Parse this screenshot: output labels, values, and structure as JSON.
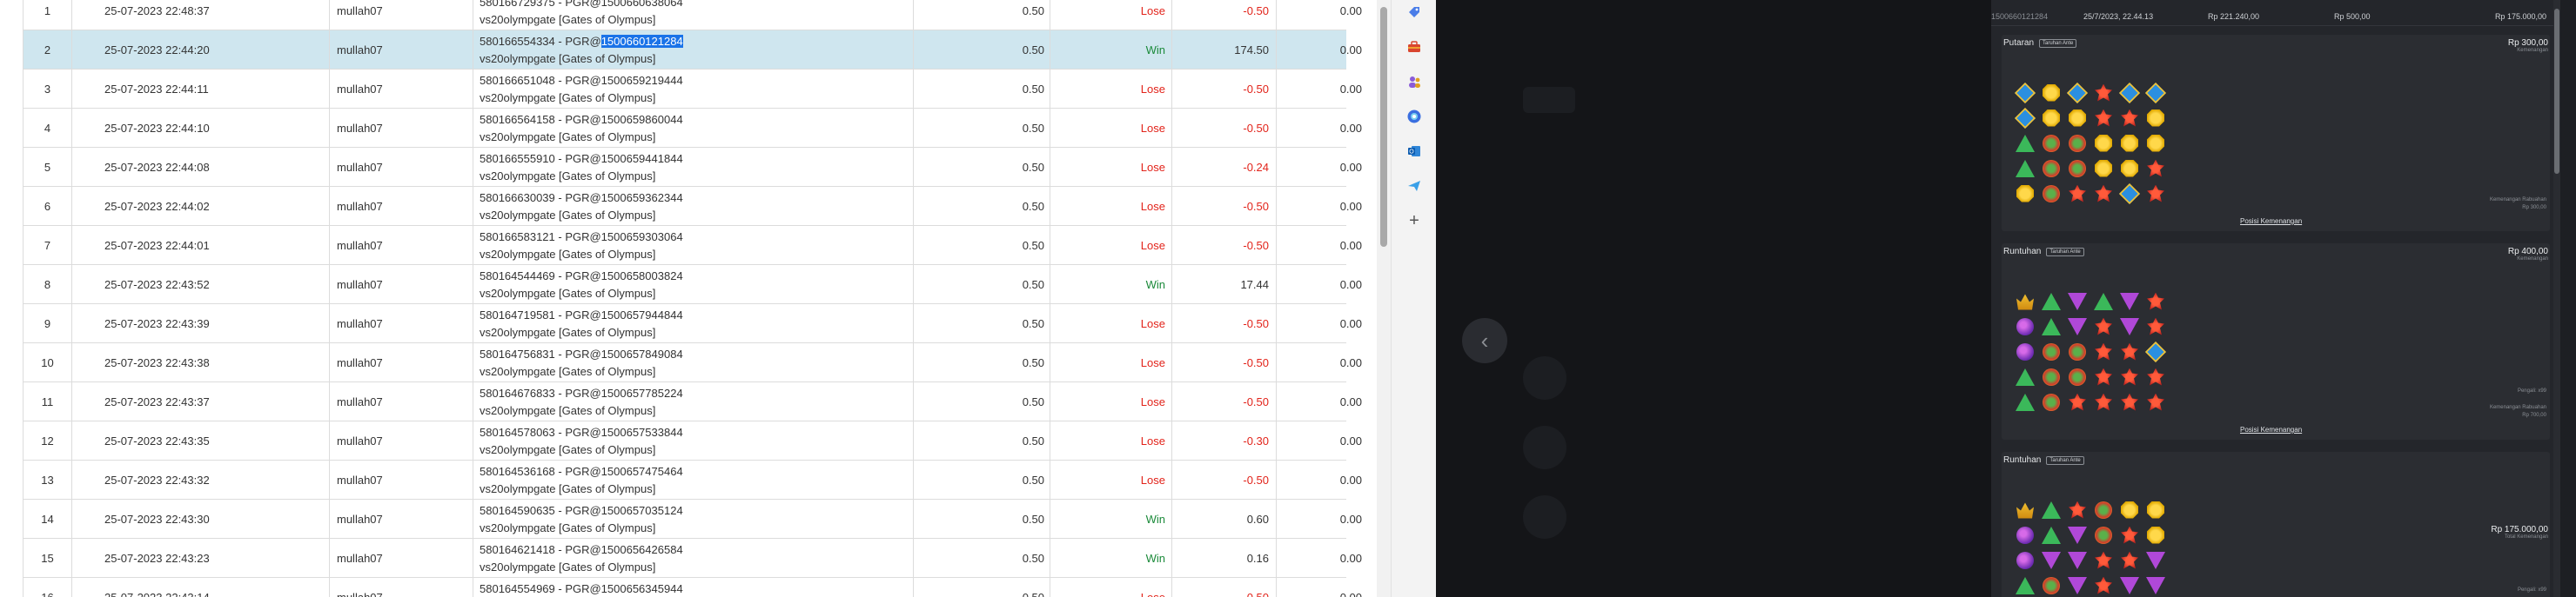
{
  "grid": {
    "rows": [
      {
        "no": "1",
        "date": "25-07-2023 22:48:37",
        "user": "mullah07",
        "desc1": "580166729375 - PGR@1500660638064",
        "desc2": "vs20olympgate [Gates of Olympus]",
        "bet": "0.50",
        "result": "Lose",
        "pl": "-0.50",
        "jp": "0.00"
      },
      {
        "no": "2",
        "date": "25-07-2023 22:44:20",
        "user": "mullah07",
        "desc1": "580166554334 - PGR@",
        "desc1_hl": "1500660121284",
        "desc2": "vs20olympgate [Gates of Olympus]",
        "bet": "0.50",
        "result": "Win",
        "pl": "174.50",
        "jp": "0.00",
        "selected": true
      },
      {
        "no": "3",
        "date": "25-07-2023 22:44:11",
        "user": "mullah07",
        "desc1": "580166651048 - PGR@1500659219444",
        "desc2": "vs20olympgate [Gates of Olympus]",
        "bet": "0.50",
        "result": "Lose",
        "pl": "-0.50",
        "jp": "0.00"
      },
      {
        "no": "4",
        "date": "25-07-2023 22:44:10",
        "user": "mullah07",
        "desc1": "580166564158 - PGR@1500659860044",
        "desc2": "vs20olympgate [Gates of Olympus]",
        "bet": "0.50",
        "result": "Lose",
        "pl": "-0.50",
        "jp": "0.00"
      },
      {
        "no": "5",
        "date": "25-07-2023 22:44:08",
        "user": "mullah07",
        "desc1": "580166555910 - PGR@1500659441844",
        "desc2": "vs20olympgate [Gates of Olympus]",
        "bet": "0.50",
        "result": "Lose",
        "pl": "-0.24",
        "jp": "0.00"
      },
      {
        "no": "6",
        "date": "25-07-2023 22:44:02",
        "user": "mullah07",
        "desc1": "580166630039 - PGR@1500659362344",
        "desc2": "vs20olympgate [Gates of Olympus]",
        "bet": "0.50",
        "result": "Lose",
        "pl": "-0.50",
        "jp": "0.00"
      },
      {
        "no": "7",
        "date": "25-07-2023 22:44:01",
        "user": "mullah07",
        "desc1": "580166583121 - PGR@1500659303064",
        "desc2": "vs20olympgate [Gates of Olympus]",
        "bet": "0.50",
        "result": "Lose",
        "pl": "-0.50",
        "jp": "0.00"
      },
      {
        "no": "8",
        "date": "25-07-2023 22:43:52",
        "user": "mullah07",
        "desc1": "580164544469 - PGR@1500658003824",
        "desc2": "vs20olympgate [Gates of Olympus]",
        "bet": "0.50",
        "result": "Win",
        "pl": "17.44",
        "jp": "0.00"
      },
      {
        "no": "9",
        "date": "25-07-2023 22:43:39",
        "user": "mullah07",
        "desc1": "580164719581 - PGR@1500657944844",
        "desc2": "vs20olympgate [Gates of Olympus]",
        "bet": "0.50",
        "result": "Lose",
        "pl": "-0.50",
        "jp": "0.00"
      },
      {
        "no": "10",
        "date": "25-07-2023 22:43:38",
        "user": "mullah07",
        "desc1": "580164756831 - PGR@1500657849084",
        "desc2": "vs20olympgate [Gates of Olympus]",
        "bet": "0.50",
        "result": "Lose",
        "pl": "-0.50",
        "jp": "0.00"
      },
      {
        "no": "11",
        "date": "25-07-2023 22:43:37",
        "user": "mullah07",
        "desc1": "580164676833 - PGR@1500657785224",
        "desc2": "vs20olympgate [Gates of Olympus]",
        "bet": "0.50",
        "result": "Lose",
        "pl": "-0.50",
        "jp": "0.00"
      },
      {
        "no": "12",
        "date": "25-07-2023 22:43:35",
        "user": "mullah07",
        "desc1": "580164578063 - PGR@1500657533844",
        "desc2": "vs20olympgate [Gates of Olympus]",
        "bet": "0.50",
        "result": "Lose",
        "pl": "-0.30",
        "jp": "0.00"
      },
      {
        "no": "13",
        "date": "25-07-2023 22:43:32",
        "user": "mullah07",
        "desc1": "580164536168 - PGR@1500657475464",
        "desc2": "vs20olympgate [Gates of Olympus]",
        "bet": "0.50",
        "result": "Lose",
        "pl": "-0.50",
        "jp": "0.00"
      },
      {
        "no": "14",
        "date": "25-07-2023 22:43:30",
        "user": "mullah07",
        "desc1": "580164590635 - PGR@1500657035124",
        "desc2": "vs20olympgate [Gates of Olympus]",
        "bet": "0.50",
        "result": "Win",
        "pl": "0.60",
        "jp": "0.00"
      },
      {
        "no": "15",
        "date": "25-07-2023 22:43:23",
        "user": "mullah07",
        "desc1": "580164621418 - PGR@1500656426584",
        "desc2": "vs20olympgate [Gates of Olympus]",
        "bet": "0.50",
        "result": "Win",
        "pl": "0.16",
        "jp": "0.00"
      },
      {
        "no": "16",
        "date": "25-07-2023 22:43:14",
        "user": "mullah07",
        "desc1": "580164554969 - PGR@1500656345944",
        "desc2": "vs20olympgate [Gates of Olympus]",
        "bet": "0.50",
        "result": "Lose",
        "pl": "-0.50",
        "jp": "0.00"
      }
    ]
  },
  "toolbar_icons": [
    "tag-icon",
    "toolbox-icon",
    "people-icon",
    "copilot-icon",
    "outlook-icon",
    "send-icon",
    "plus-icon"
  ],
  "toolbar_plus": "+",
  "history": {
    "header": {
      "id": "1500660121284",
      "date": "25/7/2023, 22.44.13",
      "balance": "Rp 221.240,00",
      "bet": "Rp 500,00",
      "win": "Rp 175.000,00"
    },
    "rounds": [
      {
        "title": "Putaran",
        "tag": "Taruhan Ante",
        "amount": "Rp 300,00",
        "amount_sub": "Kemenangan",
        "foot1": "Kemenangan Rabuahan",
        "foot2": "Rp 300,00",
        "link": "Posisi Kemenangan",
        "symbols": [
          "gem-blue",
          "gem-yellow",
          "gem-blue",
          "gem-red",
          "gem-blue",
          "gem-blue",
          "gem-blue",
          "gem-yellow",
          "gem-yellow",
          "gem-red",
          "gem-red",
          "gem-yellow",
          "gem-green",
          "gem-ring",
          "gem-ring",
          "gem-yellow",
          "gem-yellow",
          "gem-yellow",
          "gem-green",
          "gem-ring",
          "gem-ring",
          "gem-yellow",
          "gem-yellow",
          "gem-red",
          "gem-yellow",
          "gem-ring",
          "gem-red",
          "gem-red",
          "gem-blue",
          "gem-red"
        ]
      },
      {
        "title": "Runtuhan",
        "tag": "Taruhan Ante",
        "amount": "Rp 400,00",
        "amount_sub": "Kemenangan",
        "foot0": "Pengali: x99",
        "foot1": "Kemenangan Rabuahan",
        "foot2": "Rp 700,00",
        "link": "Posisi Kemenangan",
        "symbols": [
          "gem-crown",
          "gem-green",
          "gem-purple",
          "gem-green",
          "gem-purple",
          "gem-red",
          "gem-orb",
          "gem-green",
          "gem-purple",
          "gem-red",
          "gem-purple",
          "gem-red",
          "gem-orb",
          "gem-ring",
          "gem-ring",
          "gem-red",
          "gem-red",
          "gem-blue",
          "gem-green",
          "gem-ring",
          "gem-ring",
          "gem-red",
          "gem-red",
          "gem-red",
          "gem-green",
          "gem-ring",
          "gem-red",
          "gem-red",
          "gem-red",
          "gem-red"
        ]
      },
      {
        "title": "Runtuhan",
        "tag": "Taruhan Ante",
        "amount": "Rp 175.000,00",
        "amount_sub": "Total Kemenangan",
        "foot0": "Pengali: x99",
        "symbols": [
          "gem-crown",
          "gem-green",
          "gem-red",
          "gem-ring",
          "gem-yellow",
          "gem-yellow",
          "gem-orb",
          "gem-green",
          "gem-purple",
          "gem-ring",
          "gem-red",
          "gem-yellow",
          "gem-orb",
          "gem-purple",
          "gem-purple",
          "gem-red",
          "gem-red",
          "gem-purple",
          "gem-green",
          "gem-ring",
          "gem-purple",
          "gem-red",
          "gem-purple",
          "gem-purple"
        ]
      }
    ]
  },
  "colors": {
    "win": "#1b8a3a",
    "lose": "#e2231a",
    "selected_row": "#cfe6ef",
    "highlight": "#1a73e8",
    "dark_bg": "#1d1f23"
  }
}
